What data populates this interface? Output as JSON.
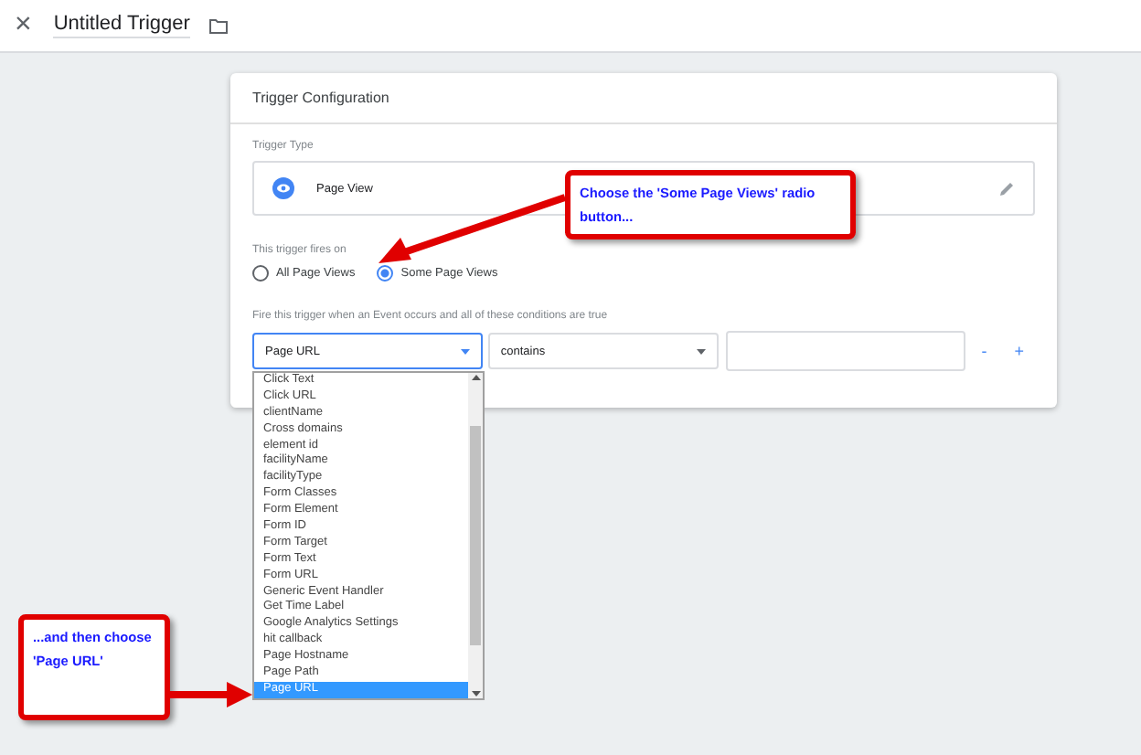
{
  "header": {
    "close": "×",
    "title": "Untitled Trigger"
  },
  "card": {
    "title": "Trigger Configuration",
    "trigger_type_label": "Trigger Type",
    "trigger_type": "Page View",
    "fires_on_label": "This trigger fires on",
    "fires_on_options": [
      {
        "label": "All Page Views",
        "selected": false
      },
      {
        "label": "Some Page Views",
        "selected": true
      }
    ],
    "conditions_label": "Fire this trigger when an Event occurs and all of these conditions are true",
    "condition": {
      "variable": "Page URL",
      "operator": "contains",
      "remove": "-",
      "add": "+"
    }
  },
  "dropdown": [
    {
      "label": "Click Text",
      "selected": false
    },
    {
      "label": "Click URL",
      "selected": false
    },
    {
      "label": "clientName",
      "selected": false
    },
    {
      "label": "Cross domains",
      "selected": false
    },
    {
      "label": "element id",
      "selected": false
    },
    {
      "label": "facilityName",
      "selected": false
    },
    {
      "label": "facilityType",
      "selected": false
    },
    {
      "label": "Form Classes",
      "selected": false
    },
    {
      "label": "Form Element",
      "selected": false
    },
    {
      "label": "Form ID",
      "selected": false
    },
    {
      "label": "Form Target",
      "selected": false
    },
    {
      "label": "Form Text",
      "selected": false
    },
    {
      "label": "Form URL",
      "selected": false
    },
    {
      "label": "Generic Event Handler",
      "selected": false
    },
    {
      "label": "Get Time Label",
      "selected": false
    },
    {
      "label": "Google Analytics Settings",
      "selected": false
    },
    {
      "label": "hit callback",
      "selected": false
    },
    {
      "label": "Page Hostname",
      "selected": false
    },
    {
      "label": "Page Path",
      "selected": false
    },
    {
      "label": "Page URL",
      "selected": true
    }
  ],
  "callouts": [
    "Choose the 'Some Page Views' radio button...",
    "...and then choose 'Page URL'"
  ]
}
